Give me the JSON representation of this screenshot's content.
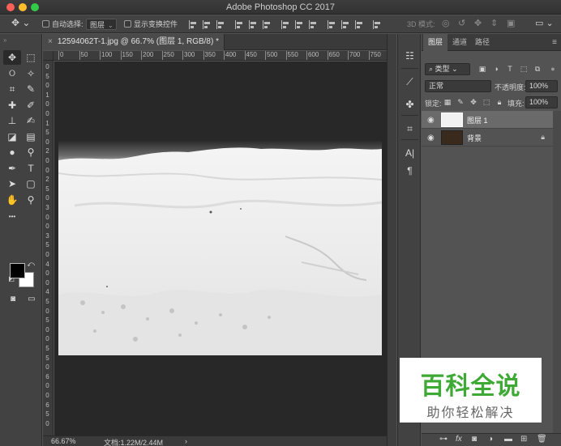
{
  "window": {
    "title": "Adobe Photoshop CC 2017"
  },
  "options_bar": {
    "auto_select_label": "自动选择:",
    "auto_select_target": "图层",
    "show_transform_label": "显示变换控件",
    "mode_3d_label": "3D 模式:"
  },
  "document": {
    "tab_title": "12594062T-1.jpg @ 66.7% (图层 1, RGB/8) *",
    "ruler_h_ticks": [
      "0",
      "50",
      "100",
      "150",
      "200",
      "250",
      "300",
      "350",
      "400",
      "450",
      "500",
      "550",
      "600",
      "650",
      "700",
      "750"
    ],
    "ruler_v_ticks": [
      "0",
      "5",
      "0",
      "1",
      "0",
      "0",
      "1",
      "5",
      "0",
      "2",
      "0",
      "0",
      "2",
      "5",
      "0",
      "3",
      "0",
      "0",
      "3",
      "5",
      "0",
      "4",
      "0",
      "0",
      "4",
      "5",
      "0",
      "5",
      "0",
      "0",
      "5",
      "5",
      "0",
      "6",
      "0",
      "0",
      "6",
      "5",
      "0"
    ]
  },
  "status": {
    "zoom": "66.67%",
    "doc_size": "文档:1.22M/2.44M",
    "arrow": "›"
  },
  "toolbar": {
    "tools": [
      {
        "icon": "move-icon",
        "glyph": "✥"
      },
      {
        "icon": "marquee-icon",
        "glyph": "⬚"
      },
      {
        "icon": "lasso-icon",
        "glyph": "ଠ"
      },
      {
        "icon": "magic-wand-icon",
        "glyph": "✧"
      },
      {
        "icon": "crop-icon",
        "glyph": "⌗"
      },
      {
        "icon": "eyedropper-icon",
        "glyph": "✎"
      },
      {
        "icon": "healing-brush-icon",
        "glyph": "✚"
      },
      {
        "icon": "brush-icon",
        "glyph": "✐"
      },
      {
        "icon": "clone-stamp-icon",
        "glyph": "⊥"
      },
      {
        "icon": "history-brush-icon",
        "glyph": "✍"
      },
      {
        "icon": "eraser-icon",
        "glyph": "◪"
      },
      {
        "icon": "gradient-icon",
        "glyph": "▤"
      },
      {
        "icon": "blur-icon",
        "glyph": "●"
      },
      {
        "icon": "dodge-icon",
        "glyph": "⚲"
      },
      {
        "icon": "pen-icon",
        "glyph": "✒"
      },
      {
        "icon": "type-icon",
        "glyph": "T"
      },
      {
        "icon": "path-selection-icon",
        "glyph": "➤"
      },
      {
        "icon": "rectangle-icon",
        "glyph": "▢"
      },
      {
        "icon": "hand-icon",
        "glyph": "✋"
      },
      {
        "icon": "zoom-icon",
        "glyph": "⚲"
      },
      {
        "icon": "more-tools-icon",
        "glyph": "•••"
      }
    ]
  },
  "layers_panel": {
    "tabs": [
      "图层",
      "通道",
      "路径"
    ],
    "filter_label": "类型",
    "blend_mode": "正常",
    "opacity_label": "不透明度:",
    "opacity_value": "100%",
    "lock_label": "锁定:",
    "fill_label": "填充:",
    "fill_value": "100%",
    "layers": [
      {
        "name": "图层 1",
        "selected": true
      },
      {
        "name": "背景",
        "selected": false,
        "locked": true
      }
    ],
    "footer_fx": "fx"
  },
  "watermark": {
    "title": "百科全说",
    "subtitle": "助你轻松解决"
  },
  "colors": {
    "foreground": "#000000",
    "background": "#ffffff",
    "watermark_green": "#3fa935"
  }
}
